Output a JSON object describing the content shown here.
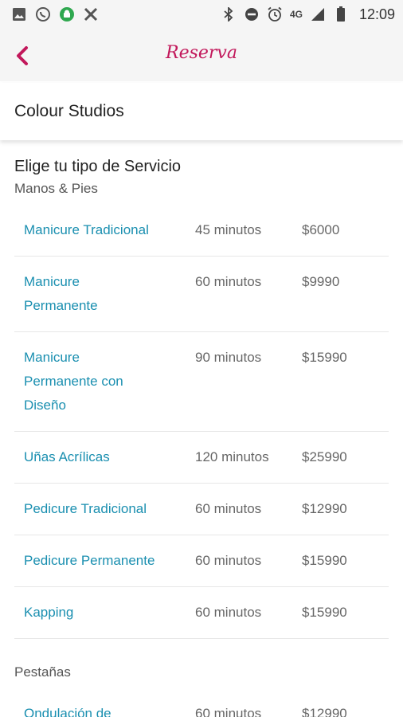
{
  "status_bar": {
    "time": "12:09",
    "network": "4G",
    "icons": [
      "gallery-icon",
      "whatsapp-icon",
      "android-icon",
      "app-icon",
      "bluetooth-icon",
      "do-not-disturb-icon",
      "alarm-icon",
      "signal-icon",
      "battery-icon"
    ]
  },
  "app_bar": {
    "title": "Reserva",
    "back_icon": "chevron-left-icon",
    "accent_color": "#c2185b"
  },
  "studio": {
    "name": "Colour Studios"
  },
  "main": {
    "section_title": "Elige tu tipo de Servicio",
    "categories": [
      {
        "title": "Manos & Pies",
        "services": [
          {
            "name": "Manicure Tradicional",
            "duration": "45 minutos",
            "price": "$6000"
          },
          {
            "name": "Manicure Permanente",
            "duration": "60 minutos",
            "price": "$9990"
          },
          {
            "name": "Manicure Permanente con Diseño",
            "duration": "90 minutos",
            "price": "$15990"
          },
          {
            "name": "Uñas Acrílicas",
            "duration": "120 minutos",
            "price": "$25990"
          },
          {
            "name": "Pedicure Tradicional",
            "duration": "60 minutos",
            "price": "$12990"
          },
          {
            "name": "Pedicure Permanente",
            "duration": "60 minutos",
            "price": "$15990"
          },
          {
            "name": "Kapping",
            "duration": "60 minutos",
            "price": "$15990"
          }
        ]
      },
      {
        "title": "Pestañas",
        "services": [
          {
            "name": "Ondulación de",
            "duration": "60 minutos",
            "price": "$12990"
          }
        ]
      }
    ],
    "link_color": "#1a8fb0"
  }
}
